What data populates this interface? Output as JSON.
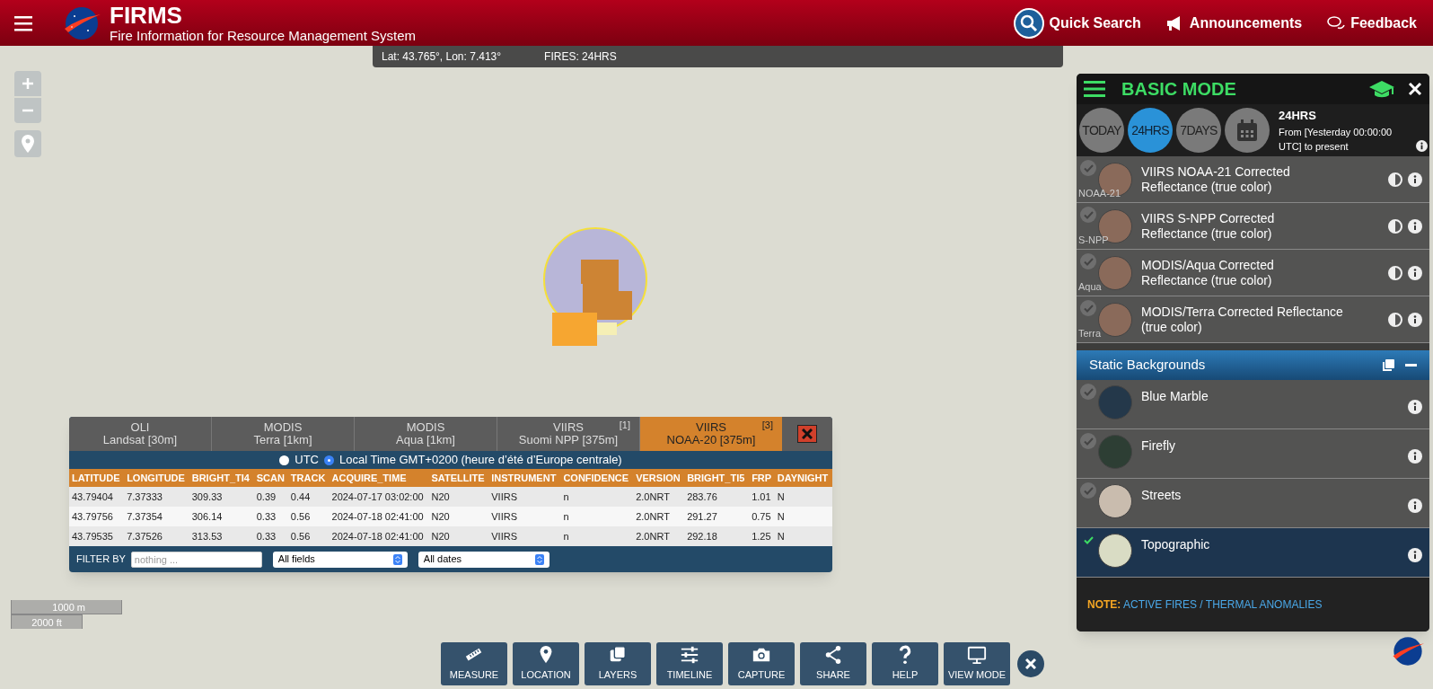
{
  "header": {
    "title": "FIRMS",
    "subtitle": "Fire Information for Resource Management System",
    "actions": [
      {
        "kind": "search",
        "label": "Quick Search"
      },
      {
        "kind": "announce",
        "label": "Announcements"
      },
      {
        "kind": "feedback",
        "label": "Feedback"
      }
    ]
  },
  "status_bar": {
    "coords": "Lat: 43.765°, Lon: 7.413°",
    "fires": "FIRES: 24HRS"
  },
  "scale": {
    "metric": "1000 m",
    "imperial": "2000 ft"
  },
  "fire_table": {
    "tabs": [
      {
        "line1": "OLI",
        "line2": "Landsat [30m]",
        "selected": false
      },
      {
        "line1": "MODIS",
        "line2": "Terra [1km]",
        "selected": false
      },
      {
        "line1": "MODIS",
        "line2": "Aqua [1km]",
        "selected": false
      },
      {
        "line1": "VIIRS",
        "line2": "Suomi NPP [375m]",
        "count": "[1]",
        "selected": false
      },
      {
        "line1": "VIIRS",
        "line2": "NOAA-20 [375m]",
        "count": "[3]",
        "selected": true
      }
    ],
    "time_options": [
      {
        "label": "UTC",
        "selected": false
      },
      {
        "label": "Local Time GMT+0200 (heure d’été d’Europe centrale)",
        "selected": true
      }
    ],
    "columns": [
      "LATITUDE",
      "LONGITUDE",
      "BRIGHT_TI4",
      "SCAN",
      "TRACK",
      "ACQUIRE_TIME",
      "SATELLITE",
      "INSTRUMENT",
      "CONFIDENCE",
      "VERSION",
      "BRIGHT_TI5",
      "FRP",
      "DAYNIGHT"
    ],
    "rows": [
      [
        "43.79404",
        "7.37333",
        "309.33",
        "0.39",
        "0.44",
        "2024-07-17 03:02:00",
        "N20",
        "VIIRS",
        "n",
        "2.0NRT",
        "283.76",
        "1.01",
        "N"
      ],
      [
        "43.79756",
        "7.37354",
        "306.14",
        "0.33",
        "0.56",
        "2024-07-18 02:41:00",
        "N20",
        "VIIRS",
        "n",
        "2.0NRT",
        "291.27",
        "0.75",
        "N"
      ],
      [
        "43.79535",
        "7.37526",
        "313.53",
        "0.33",
        "0.56",
        "2024-07-18 02:41:00",
        "N20",
        "VIIRS",
        "n",
        "2.0NRT",
        "292.18",
        "1.25",
        "N"
      ]
    ],
    "filter": {
      "label": "FILTER BY",
      "placeholder": "nothing ...",
      "field_select": "All fields",
      "date_select": "All dates"
    }
  },
  "panel": {
    "title": "BASIC MODE",
    "ranges": [
      {
        "kind": "text",
        "label": "TODAY",
        "selected": false
      },
      {
        "kind": "text",
        "label": "24HRS",
        "selected": true
      },
      {
        "kind": "text",
        "label": "7DAYS",
        "selected": false
      },
      {
        "kind": "calendar",
        "selected": false
      }
    ],
    "range_info": {
      "title": "24HRS",
      "description": "From [Yesterday 00:00:00 UTC] to present"
    },
    "imagery_layers": [
      {
        "name": "VIIRS NOAA-21 Corrected Reflectance (true color)",
        "tag": "NOAA-21",
        "checked": false
      },
      {
        "name": "VIIRS S-NPP Corrected Reflectance (true color)",
        "tag": "S-NPP",
        "checked": false
      },
      {
        "name": "MODIS/Aqua Corrected Reflectance (true color)",
        "tag": "Aqua",
        "checked": false
      },
      {
        "name": "MODIS/Terra Corrected Reflectance (true color)",
        "tag": "Terra",
        "checked": false
      }
    ],
    "section": {
      "title": "Static Backgrounds"
    },
    "backgrounds": [
      {
        "name": "Blue Marble",
        "color": "#24384a",
        "checked": false
      },
      {
        "name": "Firefly",
        "color": "#2d3e34",
        "checked": false
      },
      {
        "name": "Streets",
        "color": "#c9bcae",
        "checked": false
      },
      {
        "name": "Topographic",
        "color": "#d9dcc4",
        "checked": true
      }
    ],
    "note": {
      "label": "NOTE:",
      "link": "ACTIVE FIRES / THERMAL ANOMALIES"
    }
  },
  "toolbar": [
    {
      "kind": "ruler",
      "label": "MEASURE"
    },
    {
      "kind": "pin",
      "label": "LOCATION"
    },
    {
      "kind": "layers",
      "label": "LAYERS"
    },
    {
      "kind": "sliders",
      "label": "TIMELINE"
    },
    {
      "kind": "camera",
      "label": "CAPTURE"
    },
    {
      "kind": "share",
      "label": "SHARE"
    },
    {
      "kind": "help",
      "label": "HELP"
    },
    {
      "kind": "monitor",
      "label": "VIEW MODE"
    }
  ]
}
